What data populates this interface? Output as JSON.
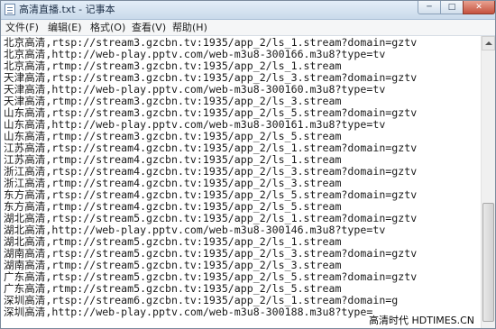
{
  "window": {
    "title": "高清直播.txt - 记事本",
    "controls": {
      "minimize_icon": "minimize-icon",
      "maximize_icon": "maximize-icon",
      "close_icon": "close-icon"
    }
  },
  "menu": [
    "文件(F)",
    "编辑(E)",
    "格式(O)",
    "查看(V)",
    "帮助(H)"
  ],
  "lines": [
    "北京高清,rtsp://stream3.gzcbn.tv:1935/app_2/ls_1.stream?domain=gztv",
    "北京高清,http://web-play.pptv.com/web-m3u8-300166.m3u8?type=tv",
    "北京高清,rtmp://stream3.gzcbn.tv:1935/app_2/ls_1.stream",
    "天津高清,rtsp://stream3.gzcbn.tv:1935/app_2/ls_3.stream?domain=gztv",
    "天津高清,http://web-play.pptv.com/web-m3u8-300160.m3u8?type=tv",
    "天津高清,rtmp://stream3.gzcbn.tv:1935/app_2/ls_3.stream",
    "山东高清,rtsp://stream3.gzcbn.tv:1935/app_2/ls_5.stream?domain=gztv",
    "山东高清,http://web-play.pptv.com/web-m3u8-300161.m3u8?type=tv",
    "山东高清,rtmp://stream3.gzcbn.tv:1935/app_2/ls_5.stream",
    "江苏高清,rtsp://stream4.gzcbn.tv:1935/app_2/ls_1.stream?domain=gztv",
    "江苏高清,rtmp://stream4.gzcbn.tv:1935/app_2/ls_1.stream",
    "浙江高清,rtsp://stream4.gzcbn.tv:1935/app_2/ls_3.stream?domain=gztv",
    "浙江高清,rtmp://stream4.gzcbn.tv:1935/app_2/ls_3.stream",
    "东方高清,rtsp://stream4.gzcbn.tv:1935/app_2/ls_5.stream?domain=gztv",
    "东方高清,rtmp://stream4.gzcbn.tv:1935/app_2/ls_5.stream",
    "湖北高清,rtsp://stream5.gzcbn.tv:1935/app_2/ls_1.stream?domain=gztv",
    "湖北高清,http://web-play.pptv.com/web-m3u8-300146.m3u8?type=tv",
    "湖北高清,rtmp://stream5.gzcbn.tv:1935/app_2/ls_1.stream",
    "湖南高清,rtsp://stream5.gzcbn.tv:1935/app_2/ls_3.stream?domain=gztv",
    "湖南高清,rtmp://stream5.gzcbn.tv:1935/app_2/ls_3.stream",
    "广东高清,rtsp://stream5.gzcbn.tv:1935/app_2/ls_5.stream?domain=gztv",
    "广东高清,rtmp://stream5.gzcbn.tv:1935/app_2/ls_5.stream",
    "深圳高清,rtsp://stream6.gzcbn.tv:1935/app_2/ls_1.stream?domain=g",
    "深圳高清,http://web-play.pptv.com/web-m3u8-300188.m3u8?type="
  ],
  "watermark": "高清时代 HDTIMES.CN"
}
